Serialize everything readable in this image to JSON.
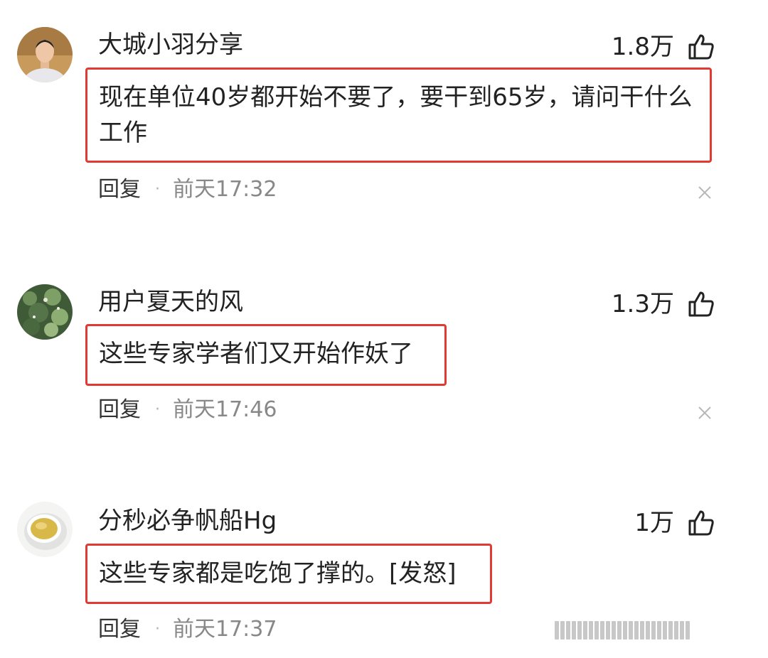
{
  "comments": [
    {
      "username": "大城小羽分享",
      "likes": "1.8万",
      "content": "现在单位40岁都开始不要了，要干到65岁，请问干什么工作",
      "reply_label": "回复",
      "separator": "·",
      "time": "前天17:32"
    },
    {
      "username": "用户夏天的风",
      "likes": "1.3万",
      "content": "这些专家学者们又开始作妖了",
      "reply_label": "回复",
      "separator": "·",
      "time": "前天17:46"
    },
    {
      "username": "分秒必争帆船Hg",
      "likes": "1万",
      "content": "这些专家都是吃饱了撑的。[发怒]",
      "reply_label": "回复",
      "separator": "·",
      "time": "前天17:37"
    }
  ],
  "icons": {
    "like": "thumbs-up-icon",
    "close": "close-icon"
  },
  "colors": {
    "highlight_border": "#e03a32",
    "text": "#222222",
    "muted": "#888888"
  }
}
